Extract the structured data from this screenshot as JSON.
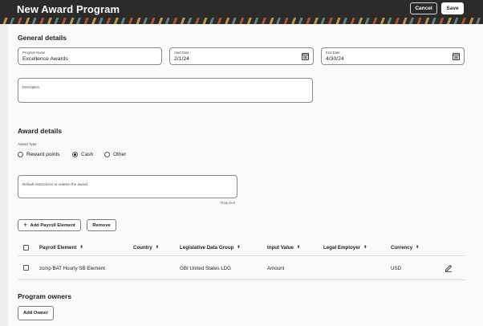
{
  "header": {
    "title": "New Award Program",
    "cancel_label": "Cancel",
    "save_label": "Save"
  },
  "general": {
    "heading": "General details",
    "program_name": {
      "label": "Program Name",
      "value": "Excellence Awards"
    },
    "start_date": {
      "label": "Start Date",
      "value": "2/1/24"
    },
    "end_date": {
      "label": "End Date",
      "value": "4/30/24"
    },
    "description": {
      "label": "Description",
      "value": ""
    }
  },
  "award": {
    "heading": "Award details",
    "type_label": "Award Type",
    "options": [
      "Reward points",
      "Cash",
      "Other"
    ],
    "selected": "Cash",
    "instructions_label": "Default instructions to redeem the award",
    "required_text": "Required",
    "add_payroll_label": "Add Payroll Element",
    "remove_label": "Remove"
  },
  "table": {
    "columns": [
      "Payroll Element",
      "Country",
      "Legislative Data Group",
      "Input Value",
      "Legal Employer",
      "Currency"
    ],
    "rows": [
      {
        "payroll_element": "zcmp BAT Hourly SB Element",
        "country": "",
        "ldg": "GBI United States LDG",
        "input_value": "Amount",
        "legal_employer": "",
        "currency": "USD"
      }
    ]
  },
  "owners": {
    "heading": "Program owners",
    "add_owner_label": "Add Owner"
  },
  "icons": {
    "calendar": "calendar-icon",
    "pencil": "pencil-icon",
    "plus": "plus-icon",
    "sort": "sort-icon"
  }
}
